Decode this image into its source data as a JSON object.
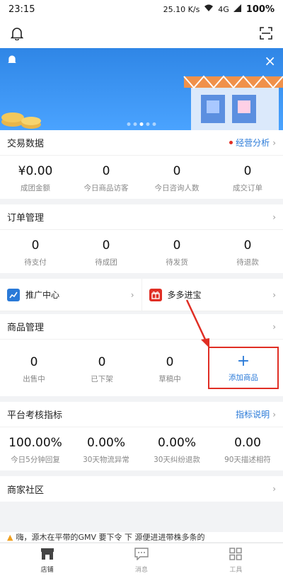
{
  "status_bar": {
    "time": "23:15",
    "network": "25.10 K/s",
    "signal": "4G",
    "battery": "100%"
  },
  "top_bar": {
    "left_icon": "bell-icon",
    "right_icon": "scan-icon"
  },
  "banner": {
    "close_label": "×",
    "dots": 5,
    "active_dot": 2
  },
  "trade": {
    "title": "交易数据",
    "link": "经营分析",
    "stats": [
      {
        "value": "¥0.00",
        "label": "成团金额"
      },
      {
        "value": "0",
        "label": "今日商品访客"
      },
      {
        "value": "0",
        "label": "今日咨询人数"
      },
      {
        "value": "0",
        "label": "成交订单"
      }
    ]
  },
  "orders": {
    "title": "订单管理",
    "stats": [
      {
        "value": "0",
        "label": "待支付"
      },
      {
        "value": "0",
        "label": "待成团"
      },
      {
        "value": "0",
        "label": "待发货"
      },
      {
        "value": "0",
        "label": "待退款"
      }
    ]
  },
  "promo": [
    {
      "label": "推广中心",
      "icon": "chart-icon",
      "color": "#2a7ad8"
    },
    {
      "label": "多多进宝",
      "icon": "gift-icon",
      "color": "#e02e24"
    }
  ],
  "products": {
    "title": "商品管理",
    "stats": [
      {
        "value": "0",
        "label": "出售中"
      },
      {
        "value": "0",
        "label": "已下架"
      },
      {
        "value": "0",
        "label": "草稿中"
      }
    ],
    "add_label": "添加商品",
    "add_symbol": "+"
  },
  "metrics": {
    "title": "平台考核指标",
    "link": "指标说明",
    "stats": [
      {
        "value": "100.00%",
        "label": "今日5分钟回复"
      },
      {
        "value": "0.00%",
        "label": "30天物流异常"
      },
      {
        "value": "0.00%",
        "label": "30天纠纷退款"
      },
      {
        "value": "0.00",
        "label": "90天描述相符"
      }
    ]
  },
  "community": {
    "title": "商家社区"
  },
  "news": {
    "text": "嗨，源木在平带的GMV 要下令 下 源便进进带株多条的"
  },
  "nav": [
    {
      "label": "店铺",
      "icon": "store-icon",
      "active": true
    },
    {
      "label": "消息",
      "icon": "message-icon",
      "active": false
    },
    {
      "label": "工具",
      "icon": "grid-icon",
      "active": false
    }
  ],
  "colors": {
    "accent": "#2a7ad8",
    "highlight": "#e02e24",
    "banner": "#3a93f0"
  }
}
